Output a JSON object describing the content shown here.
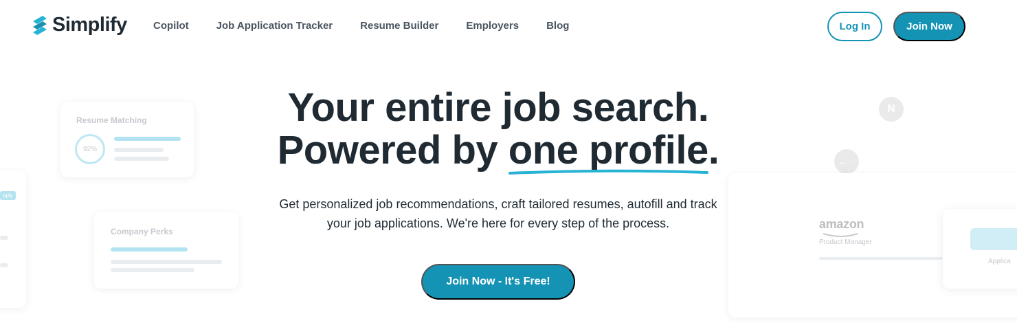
{
  "brand": {
    "name": "Simplify",
    "accent": "#1593b5",
    "dark": "#1f2a33"
  },
  "nav": {
    "links": [
      "Copilot",
      "Job Application Tracker",
      "Resume Builder",
      "Employers",
      "Blog"
    ],
    "login_label": "Log In",
    "join_label": "Join Now"
  },
  "hero": {
    "title_line1": "Your entire job search.",
    "title_line2_prefix": "Powered by ",
    "title_highlight": "one profile",
    "title_line2_suffix": ".",
    "subtitle_line1": "Get personalized job recommendations, craft tailored resumes, autofill and track",
    "subtitle_line2": "your job applications. We're here for every step of the process.",
    "cta_label": "Join Now - It's Free!"
  },
  "decor": {
    "resume_matching": {
      "title": "Resume Matching",
      "percent": "92%"
    },
    "company_perks": {
      "title": "Company Perks"
    },
    "side_badge": "pply",
    "company_n": "N",
    "amazon": {
      "logo_text": "amazon",
      "role": "Product Manager",
      "action": "Applica"
    }
  }
}
